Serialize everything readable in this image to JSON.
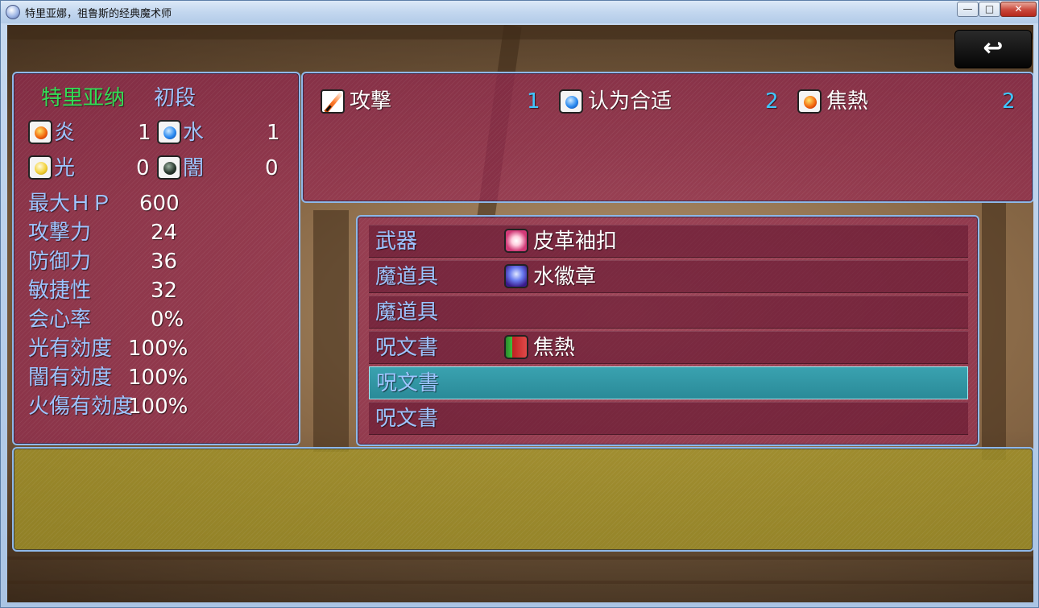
{
  "window": {
    "title": "特里亚娜，祖鲁斯的经典魔术师",
    "minimize": "—",
    "maximize": "□",
    "close": "✕"
  },
  "back_button": {
    "icon": "return-arrow-icon",
    "glyph": "↩"
  },
  "status": {
    "name": "特里亚纳",
    "rank": "初段",
    "elements": [
      {
        "icon": "fire-orb-icon",
        "label": "炎",
        "value": "1"
      },
      {
        "icon": "water-orb-icon",
        "label": "水",
        "value": "1"
      },
      {
        "icon": "light-orb-icon",
        "label": "光",
        "value": "0"
      },
      {
        "icon": "dark-orb-icon",
        "label": "闇",
        "value": "0"
      }
    ],
    "stats": [
      {
        "label": "最大ＨＰ",
        "value": "600"
      },
      {
        "label": "攻撃力",
        "value": "24"
      },
      {
        "label": "防御力",
        "value": "36"
      },
      {
        "label": "敏捷性",
        "value": "32"
      },
      {
        "label": "会心率",
        "value": "0%"
      },
      {
        "label": "光有効度",
        "value": "100%"
      },
      {
        "label": "闇有効度",
        "value": "100%"
      },
      {
        "label": "火傷有効度",
        "value": "100%"
      }
    ]
  },
  "skills": [
    {
      "icon": "attack-sword-icon",
      "name": "攻撃",
      "cost": "1"
    },
    {
      "icon": "water-orb-icon",
      "name": "认为合适",
      "cost": "2"
    },
    {
      "icon": "fire-orb-icon",
      "name": "焦熱",
      "cost": "2"
    }
  ],
  "equipment": [
    {
      "slot": "武器",
      "icon": "leather-bracer-icon",
      "item": "皮革袖扣",
      "selected": false
    },
    {
      "slot": "魔道具",
      "icon": "water-badge-icon",
      "item": "水徽章",
      "selected": false
    },
    {
      "slot": "魔道具",
      "icon": "",
      "item": "",
      "selected": false
    },
    {
      "slot": "呪文書",
      "icon": "spellbook-icon",
      "item": "焦熱",
      "selected": false
    },
    {
      "slot": "呪文書",
      "icon": "",
      "item": "",
      "selected": true
    },
    {
      "slot": "呪文書",
      "icon": "",
      "item": "",
      "selected": false
    }
  ],
  "help_text": "",
  "colors": {
    "name": "#33dd55",
    "label": "#9ec4ff",
    "value": "#ffffff",
    "skill_cost": "#3fc6ff",
    "selected_row": "#2a8a98",
    "panel_pink": "#962850",
    "panel_olive": "#a59628",
    "panel_border": "#8fb8e8"
  }
}
